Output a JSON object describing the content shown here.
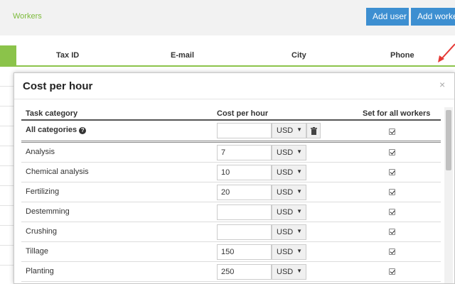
{
  "header": {
    "breadcrumb": "Workers",
    "add_user_label": "Add user",
    "add_workers_label": "Add workers"
  },
  "background_table": {
    "columns": [
      "Tax ID",
      "E-mail",
      "City",
      "Phone"
    ]
  },
  "modal": {
    "title": "Cost per hour",
    "close_glyph": "×",
    "columns": {
      "category": "Task category",
      "cost": "Cost per hour",
      "set_all": "Set for all workers"
    },
    "all_row": {
      "label": "All categories",
      "help_glyph": "?",
      "value": "",
      "currency": "USD",
      "set_for_all": true
    },
    "rows": [
      {
        "label": "Analysis",
        "value": "7",
        "currency": "USD",
        "set_for_all": true
      },
      {
        "label": "Chemical analysis",
        "value": "10",
        "currency": "USD",
        "set_for_all": true
      },
      {
        "label": "Fertilizing",
        "value": "20",
        "currency": "USD",
        "set_for_all": true
      },
      {
        "label": "Destemming",
        "value": "",
        "currency": "USD",
        "set_for_all": true
      },
      {
        "label": "Crushing",
        "value": "",
        "currency": "USD",
        "set_for_all": true
      },
      {
        "label": "Tillage",
        "value": "150",
        "currency": "USD",
        "set_for_all": true
      },
      {
        "label": "Planting",
        "value": "250",
        "currency": "USD",
        "set_for_all": true
      }
    ]
  },
  "colors": {
    "accent_green": "#8bc34a",
    "button_blue": "#3d8fd1",
    "arrow_red": "#e53935"
  }
}
